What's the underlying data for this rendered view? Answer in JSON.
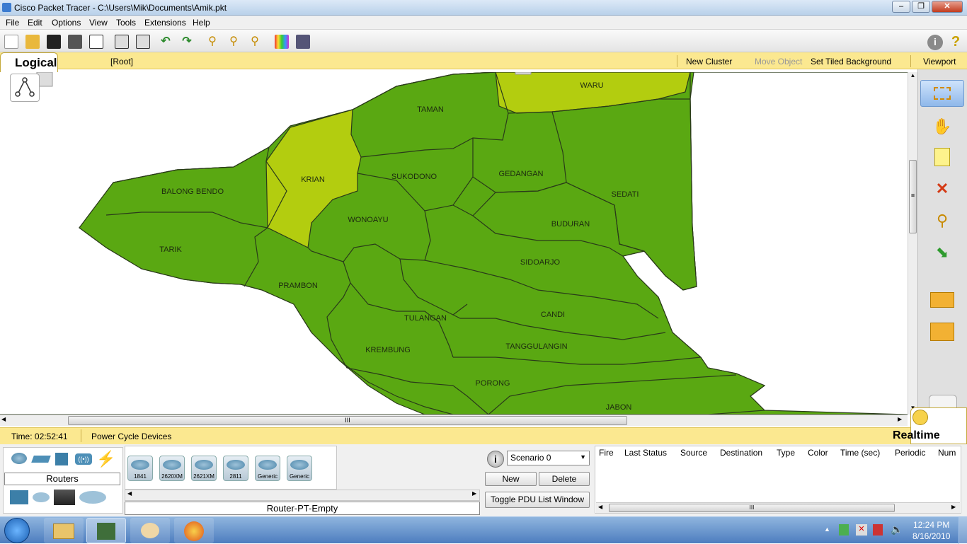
{
  "window": {
    "title": "Cisco Packet Tracer - C:\\Users\\Mik\\Documents\\Amik.pkt",
    "minimize": "–",
    "maximize": "❐",
    "close": "✕"
  },
  "menu": [
    "File",
    "Edit",
    "Options",
    "View",
    "Tools",
    "Extensions",
    "Help"
  ],
  "toolbar_icons": [
    "new-file-icon",
    "open-folder-icon",
    "save-icon",
    "print-icon",
    "activity-wizard-icon",
    "copy-icon",
    "paste-icon",
    "undo-icon",
    "redo-icon",
    "zoom-in-icon",
    "zoom-reset-icon",
    "zoom-out-icon",
    "palette-icon",
    "custom-device-icon",
    "info-icon",
    "help-icon"
  ],
  "workspace_bar": {
    "tab": "Logical",
    "breadcrumb": "[Root]",
    "new_cluster": "New Cluster",
    "move_object": "Move Object",
    "set_tiled_background": "Set Tiled Background",
    "viewport": "Viewport"
  },
  "map": {
    "regions": [
      "WARU",
      "TAMAN",
      "KRIAN",
      "SUKODONO",
      "GEDANGAN",
      "SEDATI",
      "BALONG BENDO",
      "WONOAYU",
      "BUDURAN",
      "TARIK",
      "SIDOARJO",
      "PRAMBON",
      "CANDI",
      "TULANGAN",
      "TANGGULANGIN",
      "KREMBUNG",
      "PORONG",
      "JABON"
    ],
    "colors": {
      "main": "#5aa812",
      "highlight": "#b3cd0f",
      "border": "#2a3b1a"
    }
  },
  "scrollbar": {
    "h_grip": "III",
    "v_grip": "≡"
  },
  "right_tools": [
    "select-tool",
    "move-hand-tool",
    "note-tool",
    "delete-tool",
    "inspect-tool",
    "resize-tool",
    "add-simple-pdu-tool",
    "add-complex-pdu-tool"
  ],
  "status": {
    "time": "Time: 02:52:41",
    "power_cycle": "Power Cycle Devices",
    "mode": "Realtime"
  },
  "device_panel": {
    "category_label": "Routers",
    "devices": [
      "1841",
      "2620XM",
      "2621XM",
      "2811",
      "Generic",
      "Generic"
    ],
    "selected_name": "Router-PT-Empty"
  },
  "scenario": {
    "selected": "Scenario 0",
    "new": "New",
    "delete": "Delete",
    "toggle": "Toggle PDU List Window"
  },
  "pdu_table": {
    "columns": [
      "Fire",
      "Last Status",
      "Source",
      "Destination",
      "Type",
      "Color",
      "Time (sec)",
      "Periodic",
      "Num"
    ]
  },
  "taskbar": {
    "time": "12:24 PM",
    "date": "8/16/2010"
  }
}
